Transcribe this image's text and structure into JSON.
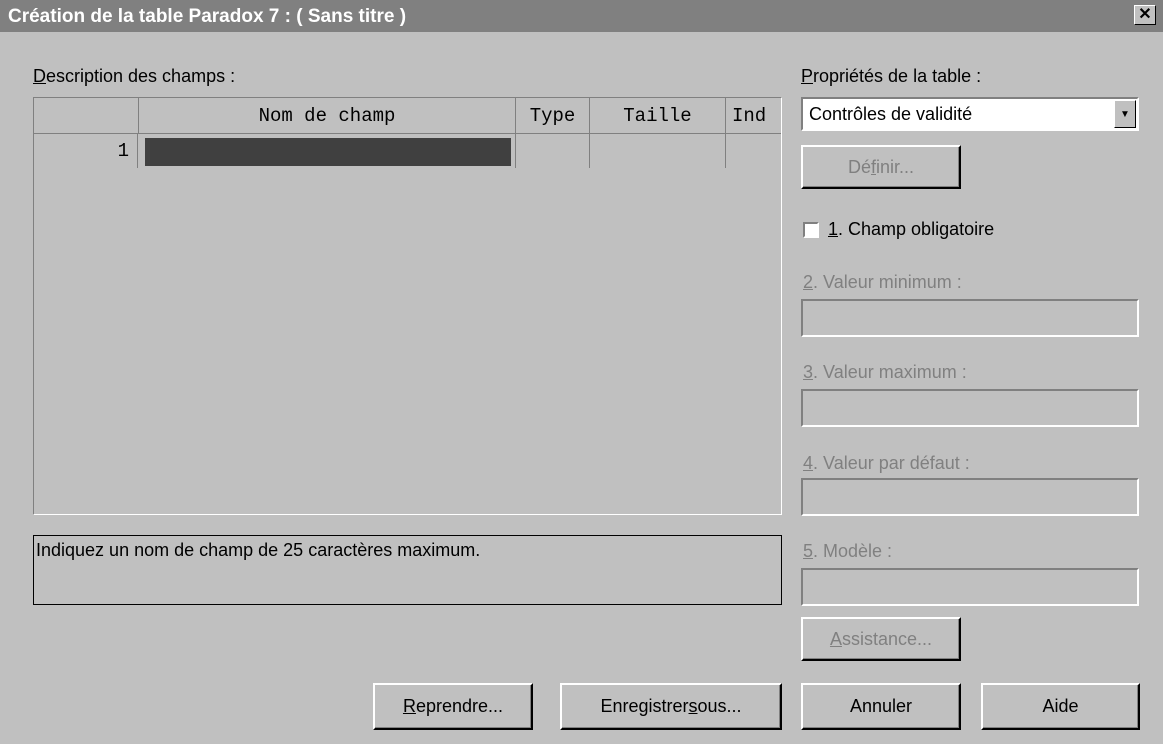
{
  "window": {
    "title": "Création de la table Paradox 7 :  ( Sans titre )",
    "close_glyph": "✕"
  },
  "fields_section": {
    "label_mnemonic": "D",
    "label_rest": "escription des champs :",
    "columns": [
      "",
      "Nom de champ",
      "Type",
      "Taille",
      "Ind"
    ],
    "rows": [
      {
        "number": "1",
        "name": "",
        "type": "",
        "size": "",
        "index": ""
      }
    ]
  },
  "hint_text": "Indiquez un nom de champ de 25 caractères maximum.",
  "properties": {
    "label_mnemonic": "P",
    "label_rest": "ropriétés de la table :",
    "selected": "Contrôles de validité",
    "define_pre": "Dé",
    "define_mnemonic": "f",
    "define_post": "inir...",
    "required_mnemonic": "1",
    "required_rest": ". Champ obligatoire",
    "required_checked": false,
    "min_mnemonic": "2",
    "min_rest": ". Valeur minimum :",
    "min_value": "",
    "max_mnemonic": "3",
    "max_rest": ". Valeur maximum :",
    "max_value": "",
    "default_mnemonic": "4",
    "default_rest": ". Valeur par défaut :",
    "default_value": "",
    "picture_mnemonic": "5",
    "picture_rest": ". Modèle :",
    "picture_value": "",
    "assist_mnemonic": "A",
    "assist_rest": "ssistance..."
  },
  "buttons": {
    "restructure_mnemonic": "R",
    "restructure_rest": "eprendre...",
    "saveas_pre": "Enregistrer ",
    "saveas_mnemonic": "s",
    "saveas_post": "ous...",
    "cancel": "Annuler",
    "help": "Aide"
  },
  "icons": {
    "dropdown": "▼"
  }
}
